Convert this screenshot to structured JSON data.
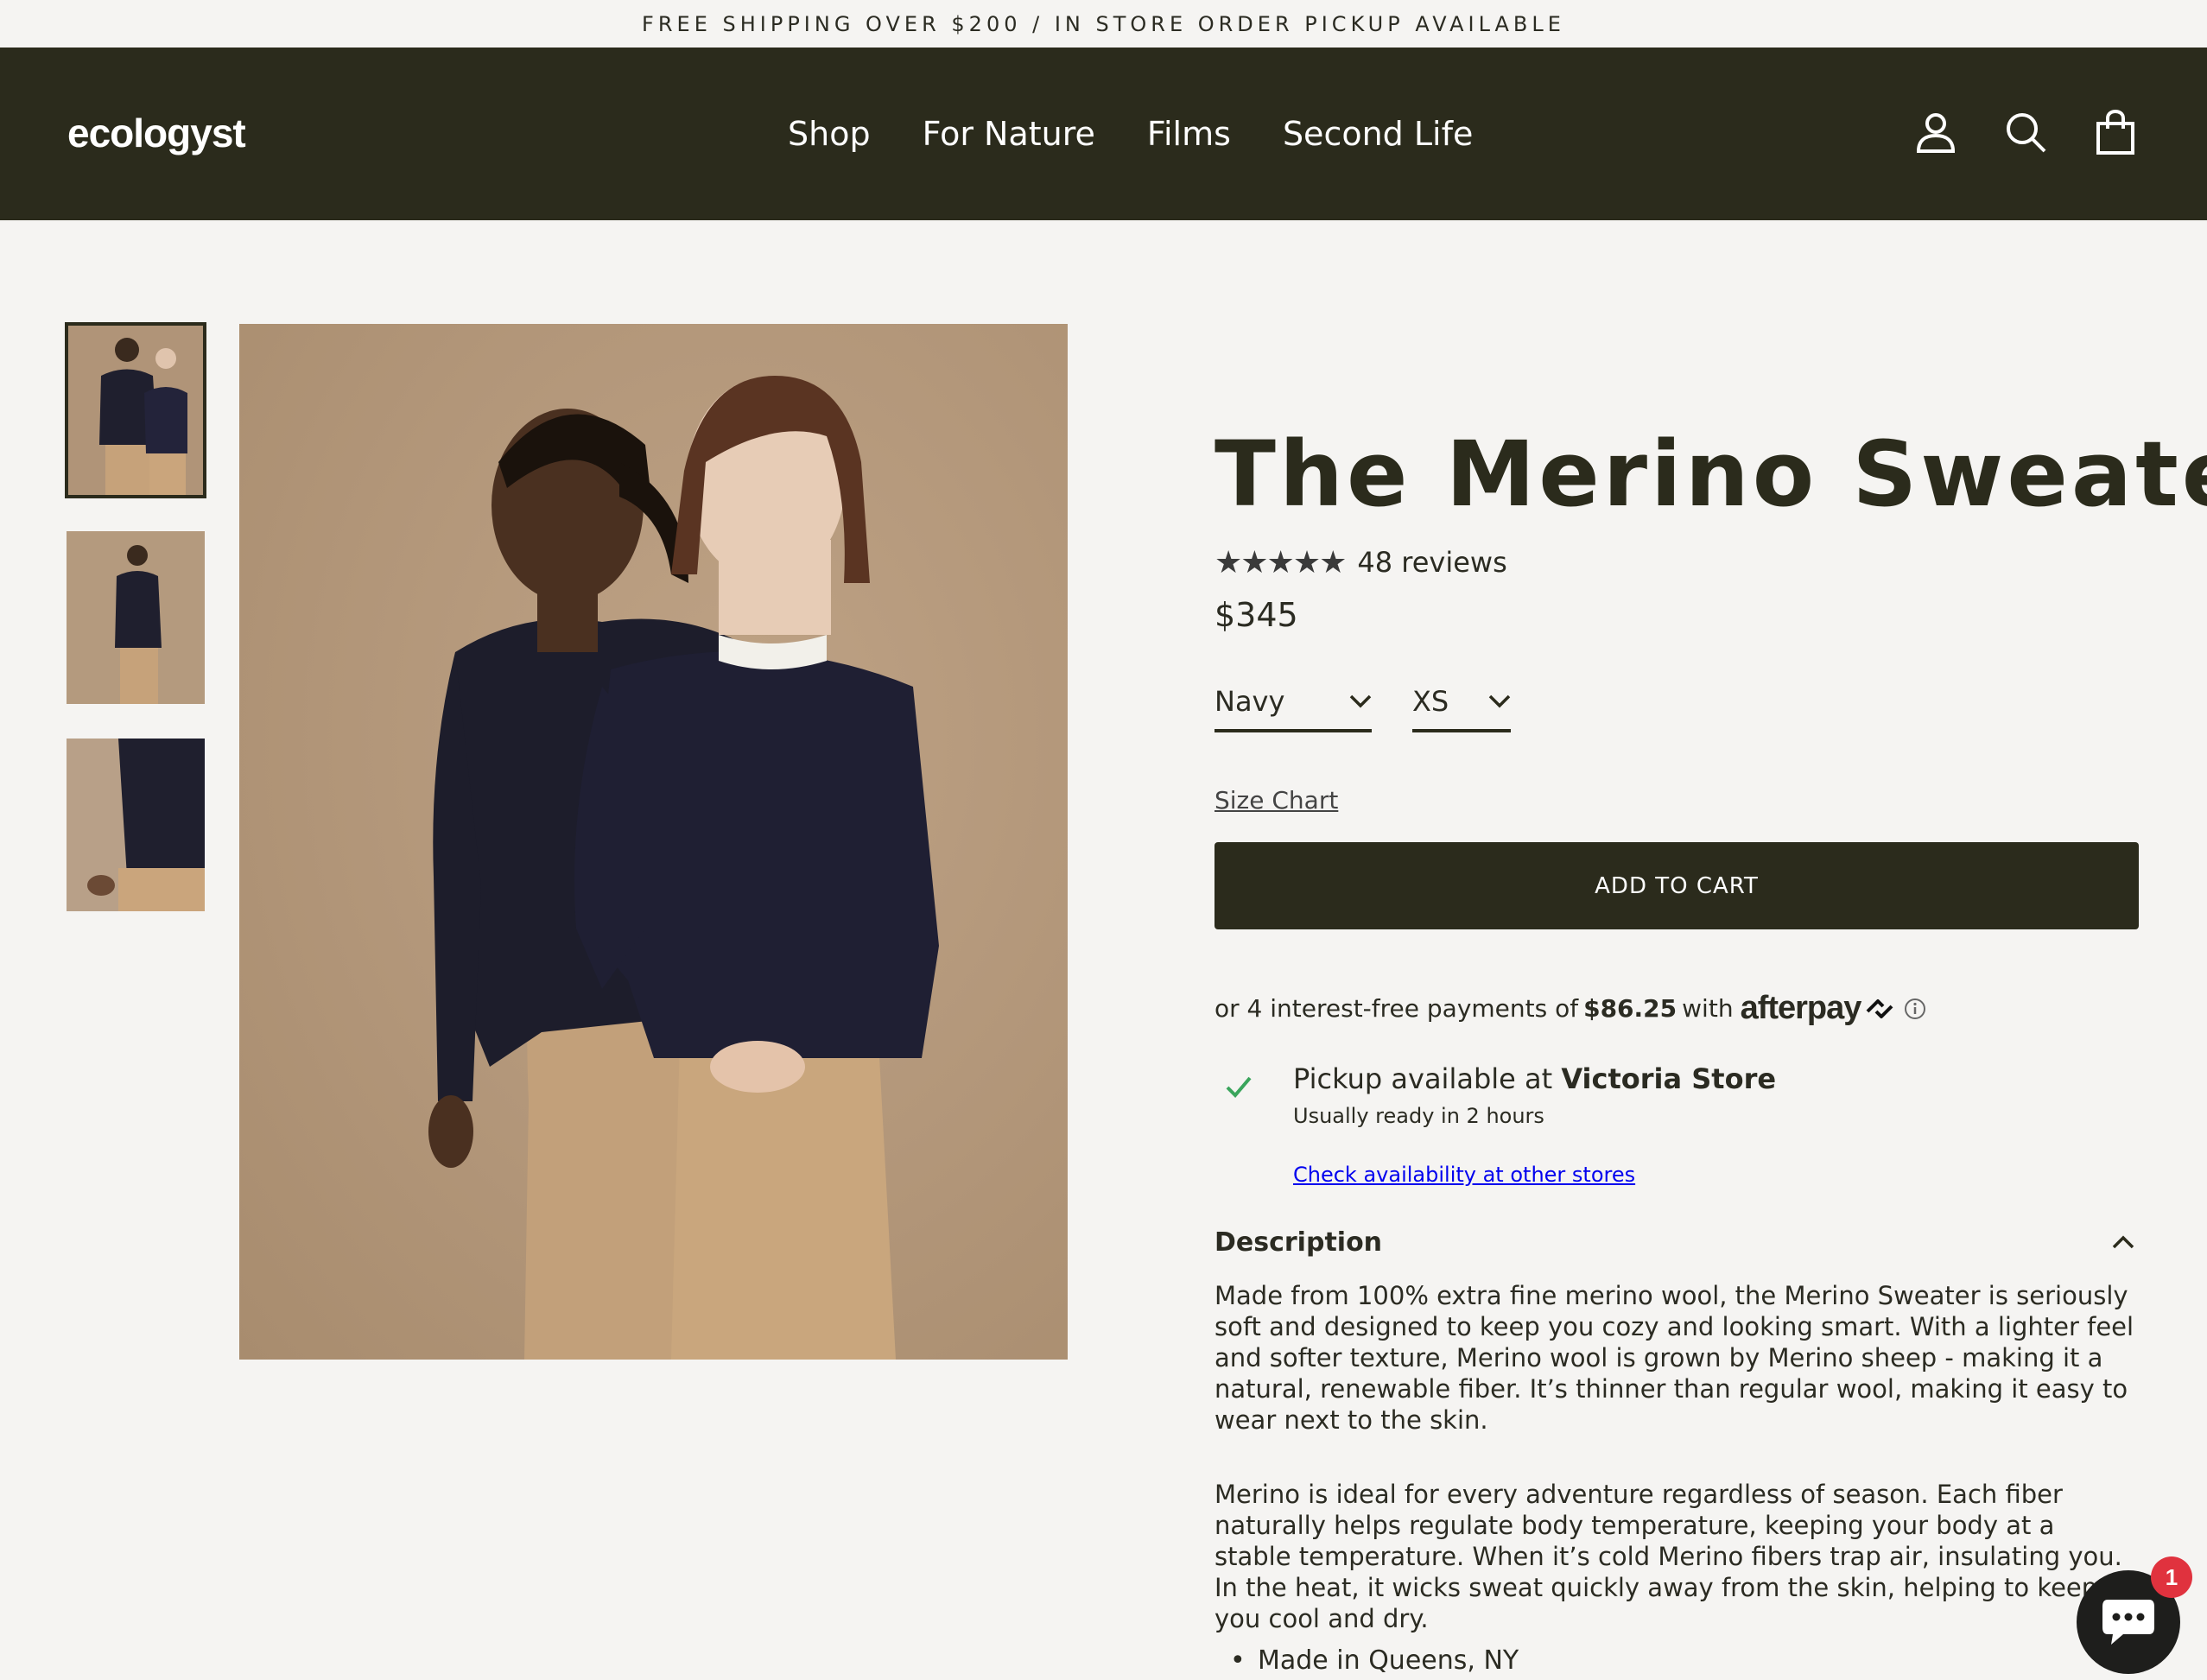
{
  "announcement": "FREE SHIPPING OVER $200 / IN STORE ORDER PICKUP AVAILABLE",
  "header": {
    "logo": "ecologyst",
    "nav": [
      "Shop",
      "For Nature",
      "Films",
      "Second Life"
    ],
    "icons": [
      "account-icon",
      "search-icon",
      "cart-icon"
    ]
  },
  "gallery": {
    "thumbnails": [
      "thumbnail-1",
      "thumbnail-2",
      "thumbnail-3"
    ],
    "active_thumbnail": 1
  },
  "product": {
    "title": "The Merino Sweater",
    "rating": 5,
    "reviews": "48 reviews",
    "price": "$345",
    "color": "Navy",
    "size": "XS",
    "size_chart": "Size Chart",
    "add_to_cart": "ADD TO CART"
  },
  "afterpay": {
    "prefix": "or 4 interest-free payments of",
    "amount": "$86.25",
    "with": "with",
    "brand": "afterpay"
  },
  "pickup": {
    "prefix": "Pickup available at ",
    "store": "Victoria Store",
    "ready": "Usually ready in 2 hours",
    "check_link": "Check availability at other stores"
  },
  "description": {
    "heading": "Description",
    "p1": "Made from 100% extra fine merino wool, the Merino Sweater is seriously soft and designed to keep you cozy and looking smart. With a lighter feel and softer texture, Merino wool is grown by Merino sheep - making it a natural, renewable fiber. It’s thinner than regular wool, making it easy to wear next to the skin.",
    "p2": "Merino is ideal for every adventure regardless of season. Each fiber naturally helps regulate body temperature, keeping your body at a stable temperature. When it’s cold Merino fibers trap air, insulating you. In the heat, it wicks sweat quickly away from the skin, helping to keep you cool and dry.",
    "bullets": [
      "Made in Queens, NY"
    ]
  },
  "chat": {
    "badge": "1"
  },
  "colors": {
    "header_bg": "#2b2b1c",
    "page_bg": "#f5f4f2",
    "photo_bg": "#b29679",
    "sweater": "#1f1f2e",
    "pants": "#c6a27a",
    "check": "#3aa55c",
    "badge": "#e0323e"
  }
}
